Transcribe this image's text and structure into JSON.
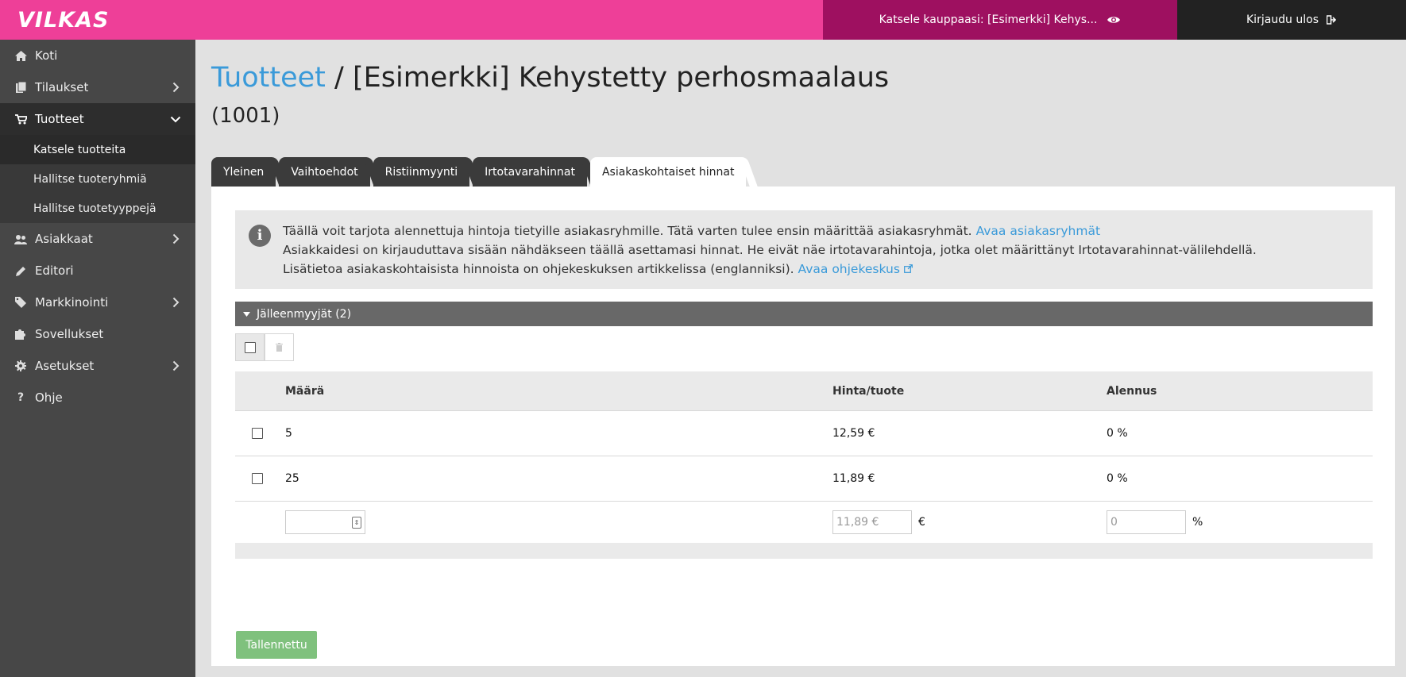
{
  "header": {
    "logo": "VILKAS",
    "view_store": "Katsele kauppaasi: [Esimerkki] Kehys...",
    "logout": "Kirjaudu ulos"
  },
  "sidebar": {
    "items": [
      {
        "label": "Koti",
        "icon": "home-icon"
      },
      {
        "label": "Tilaukset",
        "icon": "orders-icon"
      },
      {
        "label": "Tuotteet",
        "icon": "cart-icon"
      },
      {
        "label": "Asiakkaat",
        "icon": "users-icon"
      },
      {
        "label": "Editori",
        "icon": "pencil-icon"
      },
      {
        "label": "Markkinointi",
        "icon": "tag-icon"
      },
      {
        "label": "Sovellukset",
        "icon": "puzzle-icon"
      },
      {
        "label": "Asetukset",
        "icon": "gear-icon"
      },
      {
        "label": "Ohje",
        "icon": "question-icon"
      }
    ],
    "subitems": [
      {
        "label": "Katsele tuotteita"
      },
      {
        "label": "Hallitse tuoteryhmiä"
      },
      {
        "label": "Hallitse tuotetyyppejä"
      }
    ]
  },
  "page": {
    "breadcrumb": "Tuotteet",
    "separator": "/",
    "title": "[Esimerkki] Kehystetty perhosmaalaus",
    "code": "(1001)"
  },
  "tabs": [
    {
      "label": "Yleinen"
    },
    {
      "label": "Vaihtoehdot"
    },
    {
      "label": "Ristiinmyynti"
    },
    {
      "label": "Irtotavarahinnat"
    },
    {
      "label": "Asiakaskohtaiset hinnat"
    }
  ],
  "info": {
    "line1": "Täällä voit tarjota alennettuja hintoja tietyille asiakasryhmille. Tätä varten tulee ensin määrittää asiakasryhmät.",
    "line1_link": "Avaa asiakasryhmät",
    "line2": "Asiakkaidesi on kirjauduttava sisään nähdäkseen täällä asettamasi hinnat. He eivät näe irtotavarahintoja, jotka olet määrittänyt Irtotavarahinnat-välilehdellä.",
    "line3": "Lisätietoa asiakaskohtaisista hinnoista on ohjekeskuksen artikkelissa (englanniksi).",
    "line3_link": "Avaa ohjekeskus"
  },
  "group": {
    "label": "Jälleenmyyjät (2)"
  },
  "table": {
    "headers": {
      "qty": "Määrä",
      "price": "Hinta/tuote",
      "discount": "Alennus"
    },
    "rows": [
      {
        "qty": "5",
        "price": "12,59 €",
        "discount": "0 %"
      },
      {
        "qty": "25",
        "price": "11,89 €",
        "discount": "0 %"
      }
    ],
    "new_row": {
      "qty_value": "",
      "price_placeholder": "11,89 €",
      "price_unit": "€",
      "discount_placeholder": "0",
      "discount_unit": "%"
    }
  },
  "save_button": "Tallennettu",
  "colors": {
    "brand": "#ee3f98",
    "store_bar": "#9e1060",
    "link": "#3a9ad9",
    "save": "#7fc17d"
  }
}
